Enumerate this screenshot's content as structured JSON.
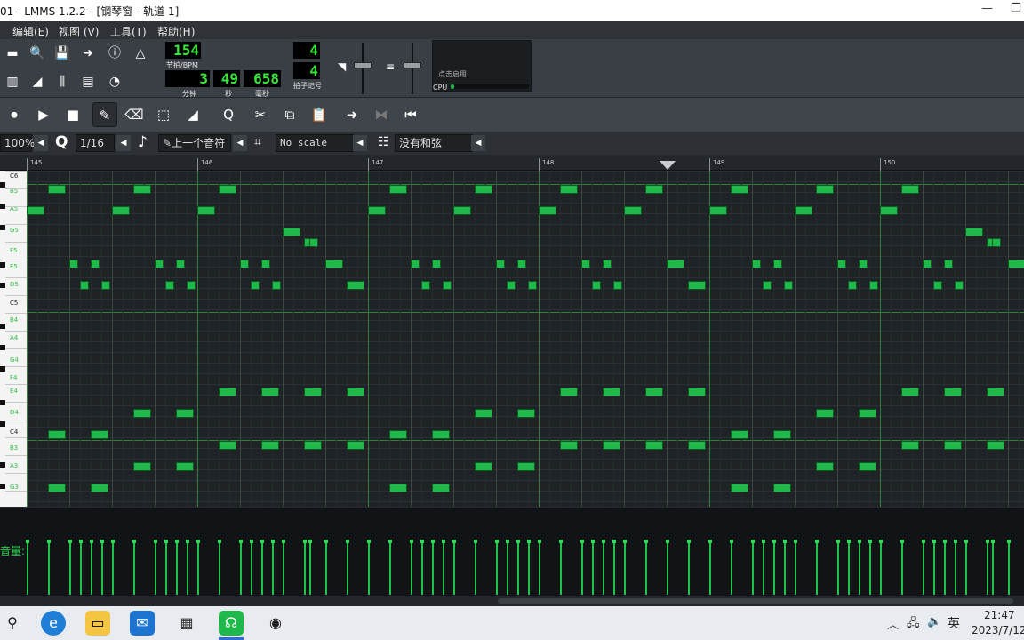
{
  "window": {
    "title": "01 - LMMS 1.2.2 - [钢琴窗 - 轨道 1]",
    "minimize": "—",
    "maximize": "❐"
  },
  "menu": [
    "编辑(E)",
    "视图 (V)",
    "工具(T)",
    "帮助(H)"
  ],
  "transport": {
    "tempo": "154",
    "tempo_label": "节拍/BPM",
    "min": "3",
    "min_label": "分钟",
    "sec": "49",
    "sec_label": "秒",
    "ms": "658",
    "ms_label": "毫秒",
    "ts_num": "4",
    "ts_den": "4",
    "ts_label": "拍子记号",
    "cpu_hint": "点击启用",
    "cpu_label": "CPU"
  },
  "editor": {
    "zoom": "100%",
    "quantize": "1/16",
    "note_length": "上一个音符",
    "scale": "No scale",
    "chord": "没有和弦"
  },
  "timeline": {
    "bars": [
      "145",
      "146",
      "147",
      "148",
      "149",
      "150"
    ]
  },
  "keys": [
    {
      "label": "C6",
      "c": true
    },
    {
      "label": "B5"
    },
    {
      "label": "A5"
    },
    {
      "label": "G5"
    },
    {
      "label": "F5"
    },
    {
      "label": "E5"
    },
    {
      "label": "D5"
    },
    {
      "label": "C5",
      "c": true
    },
    {
      "label": "B4"
    },
    {
      "label": "A4"
    },
    {
      "label": "G4"
    },
    {
      "label": "F4"
    },
    {
      "label": "E4"
    },
    {
      "label": "D4"
    },
    {
      "label": "C4",
      "c": true
    },
    {
      "label": "B3"
    },
    {
      "label": "A3"
    },
    {
      "label": "G3"
    }
  ],
  "velocity_label": "音量:",
  "taskbar": {
    "clock_time": "21:47",
    "clock_date": "2023/7/12",
    "ime": "英"
  },
  "colors": {
    "note": "#1fb84a",
    "lcd_text": "#38e838",
    "grid_bar": "#2e7f3b",
    "grid_beat": "#303a34"
  }
}
